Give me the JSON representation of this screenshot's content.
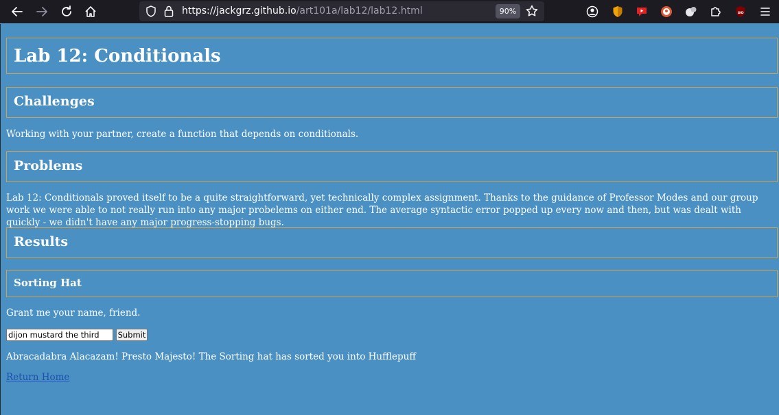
{
  "browser": {
    "url_host": "https://jackgrz.github.io",
    "url_path": "/art101a/lab12/lab12.html",
    "zoom": "90%"
  },
  "page": {
    "title": "Lab 12: Conditionals",
    "challenges_heading": "Challenges",
    "challenges_text": "Working with your partner, create a function that depends on conditionals.",
    "problems_heading": "Problems",
    "problems_text": "Lab 12: Conditionals proved itself to be a quite straightforward, yet technically complex assignment. Thanks to the guidance of Professor Modes and our group work we were able to not really run into any major probelems on either end. The average syntactic error popped up every now and then, but was dealt with quickly - we didn't have any major progress-stopping bugs.",
    "results_heading": "Results",
    "sorting_heading": "Sorting Hat",
    "prompt_text": "Grant me your name, friend.",
    "name_value": "dijon mustard the third",
    "submit_label": "Submit",
    "result_text": "Abracadabra Alacazam! Presto Majesto! The Sorting hat has sorted you into Hufflepuff",
    "home_link": "Return Home"
  }
}
